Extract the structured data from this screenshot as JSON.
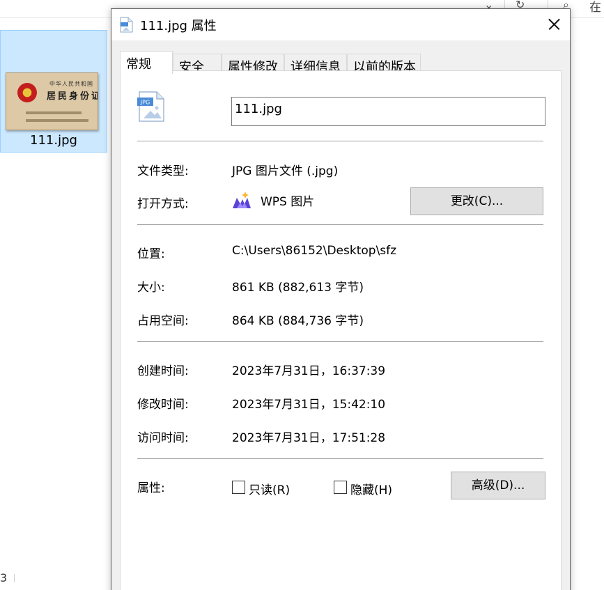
{
  "background": {
    "file_tile": {
      "name": "111.jpg"
    },
    "thumbnail_text": {
      "line1": "中华人民共和国",
      "line2": "居民身份证"
    },
    "toolbar_partial_text": "在",
    "corner_text": "3"
  },
  "dialog": {
    "title": "111.jpg 属性",
    "tabs": [
      {
        "label": "常规"
      },
      {
        "label": "安全"
      },
      {
        "label": "属性修改"
      },
      {
        "label": "详细信息"
      },
      {
        "label": "以前的版本"
      }
    ],
    "file_name_value": "111.jpg",
    "file_icon_badge": "JPG",
    "rows": {
      "file_type": {
        "label": "文件类型:",
        "value": "JPG 图片文件 (.jpg)"
      },
      "open_with": {
        "label": "打开方式:",
        "value": "WPS 图片",
        "change_button": "更改(C)..."
      },
      "location": {
        "label": "位置:",
        "value": "C:\\Users\\86152\\Desktop\\sfz"
      },
      "size": {
        "label": "大小:",
        "value": "861 KB (882,613 字节)"
      },
      "size_on_disk": {
        "label": "占用空间:",
        "value": "864 KB (884,736 字节)"
      },
      "created": {
        "label": "创建时间:",
        "value": "2023年7月31日，16:37:39"
      },
      "modified": {
        "label": "修改时间:",
        "value": "2023年7月31日，15:42:10"
      },
      "accessed": {
        "label": "访问时间:",
        "value": "2023年7月31日，17:51:28"
      },
      "attributes": {
        "label": "属性:",
        "readonly_label": "只读(R)",
        "hidden_label": "隐藏(H)",
        "advanced_button": "高级(D)..."
      }
    }
  },
  "colors": {
    "selection_fill": "#cce8ff",
    "selection_border": "#99d1ff",
    "dialog_bg": "#f0f0f0",
    "button_bg": "#e1e1e1",
    "jpg_icon_blue": "#4a8bd8"
  }
}
